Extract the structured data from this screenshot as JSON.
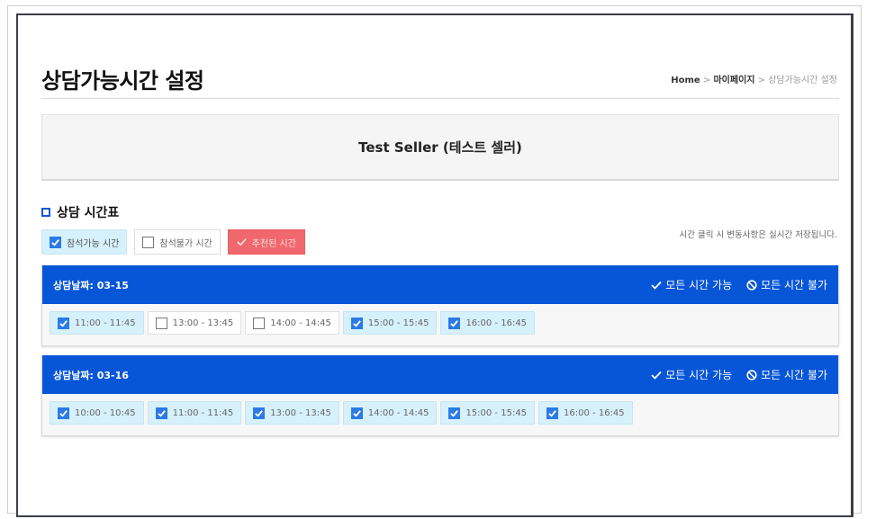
{
  "page": {
    "title": "상담가능시간 설정",
    "breadcrumb": {
      "home": "Home",
      "sep1": " > ",
      "mypage": "마이페이지",
      "sep2": " > ",
      "current": "상담가능시간 설정"
    },
    "seller_name": "Test Seller (테스트 셀러)"
  },
  "section": {
    "title": "상담 시간표",
    "note": "시간 클릭 시 변동사항은 실시간 저장됩니다."
  },
  "legend": {
    "available": "참석가능 시간",
    "unavailable": "참석불가 시간",
    "selected": "추천된 시간"
  },
  "days": [
    {
      "date_label": "상담날짜: 03-15",
      "all_available": "모든 시간 가능",
      "all_unavailable": "모든 시간 불가",
      "slots": [
        {
          "time": "11:00 - 11:45",
          "checked": true
        },
        {
          "time": "13:00 - 13:45",
          "checked": false
        },
        {
          "time": "14:00 - 14:45",
          "checked": false
        },
        {
          "time": "15:00 - 15:45",
          "checked": true
        },
        {
          "time": "16:00 - 16:45",
          "checked": true
        }
      ]
    },
    {
      "date_label": "상담날짜: 03-16",
      "all_available": "모든 시간 가능",
      "all_unavailable": "모든 시간 불가",
      "slots": [
        {
          "time": "10:00 - 10:45",
          "checked": true
        },
        {
          "time": "11:00 - 11:45",
          "checked": true
        },
        {
          "time": "13:00 - 13:45",
          "checked": true
        },
        {
          "time": "14:00 - 14:45",
          "checked": true
        },
        {
          "time": "15:00 - 15:45",
          "checked": true
        },
        {
          "time": "16:00 - 16:45",
          "checked": true
        }
      ]
    }
  ],
  "colors": {
    "header_blue": "#0756d8",
    "available_bg": "#d6f1fb",
    "selected_red": "#f0686d",
    "checkbox_blue": "#2c7be5"
  }
}
